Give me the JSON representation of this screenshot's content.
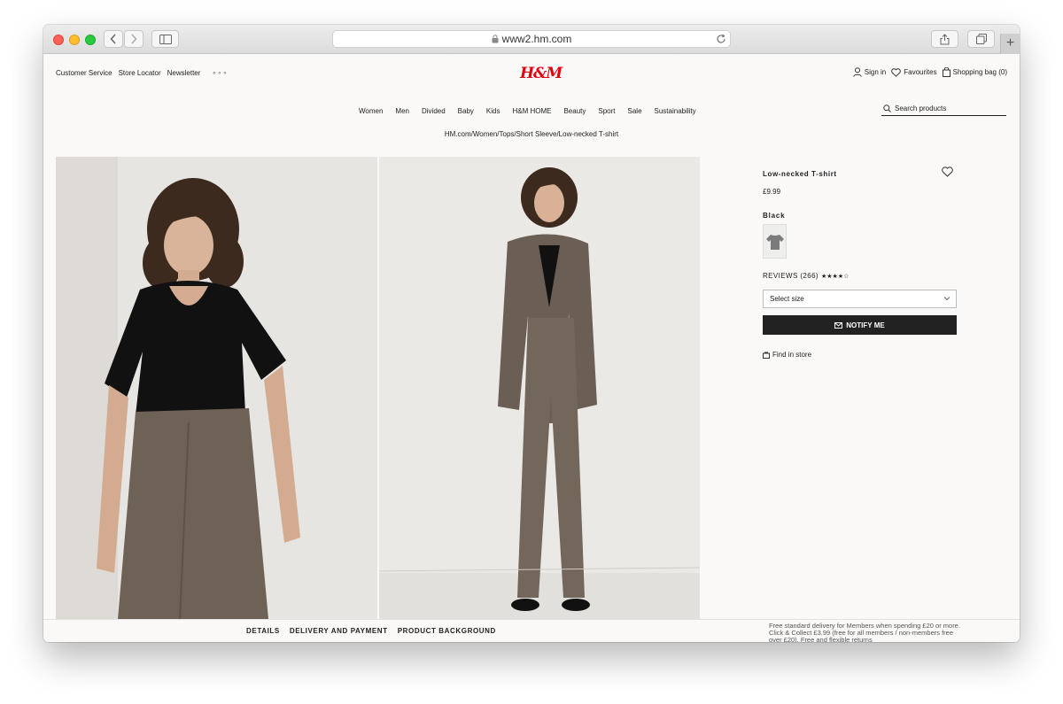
{
  "browser": {
    "url": "www2.hm.com"
  },
  "header": {
    "utility_left": [
      "Customer Service",
      "Store Locator",
      "Newsletter"
    ],
    "more": "∘∘∘",
    "logo": "H&M",
    "sign_in": "Sign in",
    "favourites": "Favourites",
    "shopping_bag": "Shopping bag (0)"
  },
  "nav": {
    "items": [
      "Women",
      "Men",
      "Divided",
      "Baby",
      "Kids",
      "H&M HOME",
      "Beauty",
      "Sport",
      "Sale",
      "Sustainability"
    ],
    "search_placeholder": "Search products"
  },
  "breadcrumb": "HM.com/Women/Tops/Short Sleeve/Low-necked T-shirt",
  "product": {
    "name": "Low-necked T-shirt",
    "price": "£9.99",
    "color": "Black",
    "reviews_label": "REVIEWS (266)",
    "stars": "★★★★☆",
    "rating_fraction": 0.85,
    "size_placeholder": "Select size",
    "notify_button": "NOTIFY ME",
    "find_in_store": "Find in store"
  },
  "bottom": {
    "tabs": [
      "DETAILS",
      "DELIVERY AND PAYMENT",
      "PRODUCT BACKGROUND"
    ],
    "delivery_note": "Free standard delivery for Members when spending £20 or more. Click & Collect £3.99 (free for all members / non-members free over £20). Free and flexible returns"
  },
  "colors": {
    "brand_red": "#e50010",
    "button_dark": "#222222",
    "page_bg": "#faf9f8"
  }
}
